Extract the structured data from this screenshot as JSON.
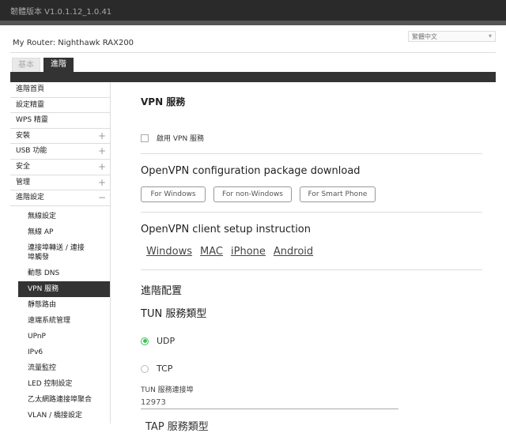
{
  "header": {
    "firmware": "韌體版本 V1.0.1.12_1.0.41"
  },
  "router_name": "My Router: Nighthawk RAX200",
  "language": {
    "selected": "繁體中文"
  },
  "tabs": {
    "basic": "基本",
    "advanced": "進階"
  },
  "sidebar": {
    "items": [
      {
        "label": "進階首頁",
        "pm": ""
      },
      {
        "label": "設定精靈",
        "pm": ""
      },
      {
        "label": "WPS 精靈",
        "pm": ""
      },
      {
        "label": "安裝",
        "pm": "+"
      },
      {
        "label": "USB 功能",
        "pm": "+"
      },
      {
        "label": "安全",
        "pm": "+"
      },
      {
        "label": "管理",
        "pm": "+"
      },
      {
        "label": "進階設定",
        "pm": "−"
      }
    ],
    "sub_items": [
      "無線設定",
      "無線 AP",
      "連接埠轉送 / 連接埠觸發",
      "動態 DNS",
      "VPN 服務",
      "靜態路由",
      "遠端系統管理",
      "UPnP",
      "IPv6",
      "流量監控",
      "LED 控制設定",
      "乙太網路連接埠聚合",
      "VLAN / 橋接設定"
    ]
  },
  "main": {
    "title": "VPN 服務",
    "enable_label": "啟用 VPN 服務",
    "download_heading": "OpenVPN configuration package download",
    "buttons": {
      "windows": "For Windows",
      "non_windows": "For non-Windows",
      "smartphone": "For Smart Phone"
    },
    "client_heading": "OpenVPN client setup instruction",
    "client_links": {
      "windows": "Windows",
      "mac": "MAC",
      "iphone": "iPhone",
      "android": "Android"
    },
    "advanced_heading": "進階配置",
    "tun_heading": "TUN 服務類型",
    "udp": "UDP",
    "tcp": "TCP",
    "tun_port_label": "TUN 服務連接埠",
    "tun_port_value": "12973",
    "tap_heading": "TAP 服務類型"
  }
}
